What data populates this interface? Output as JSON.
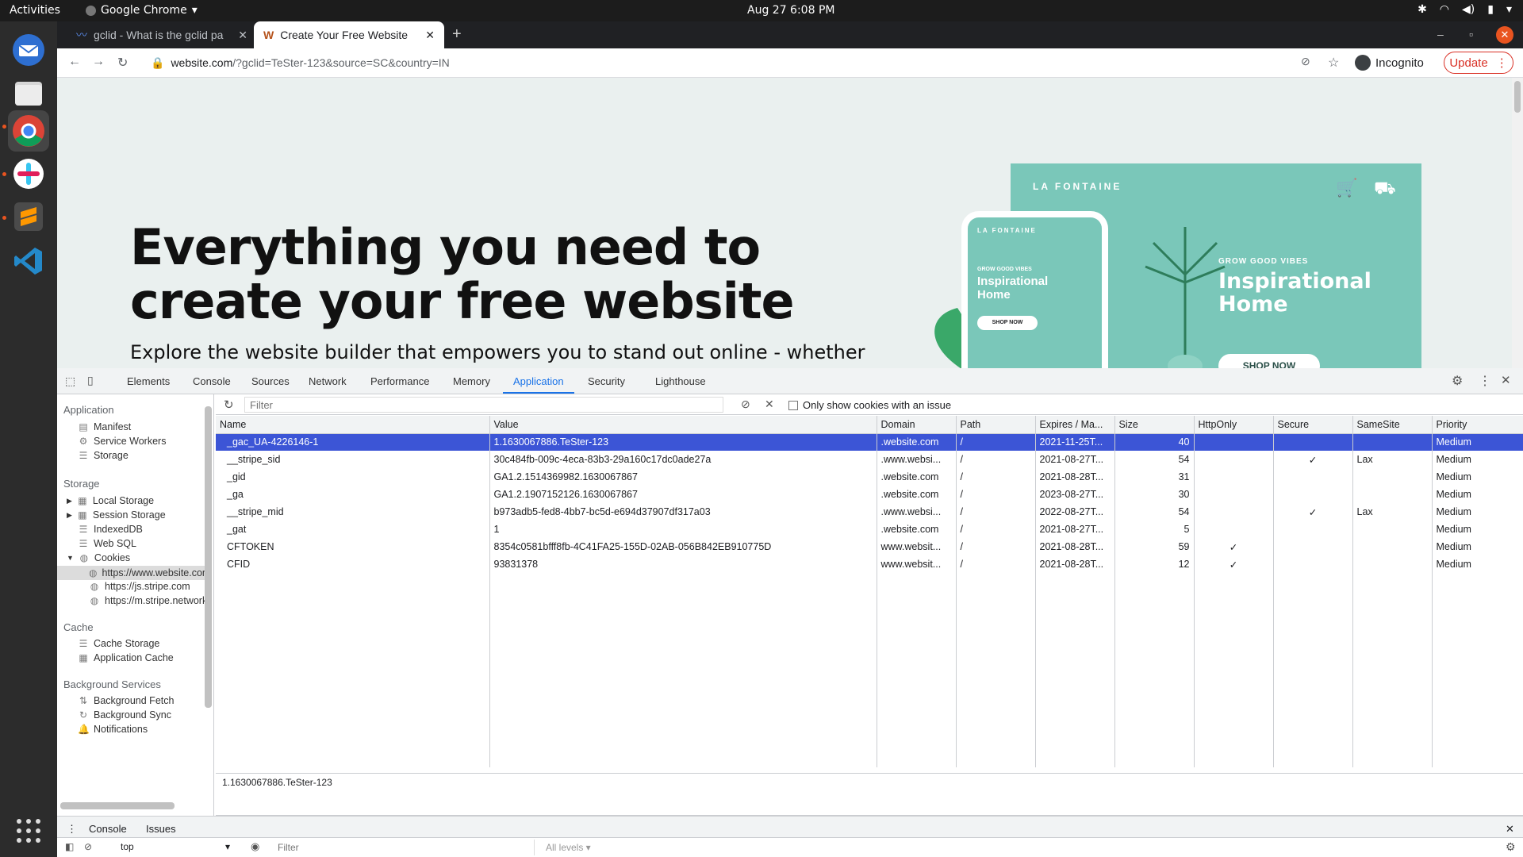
{
  "os": {
    "activities": "Activities",
    "app_name": "Google Chrome",
    "clock": "Aug 27  6:08 PM"
  },
  "tabs": [
    {
      "title": "gclid - What is the gclid pa",
      "active": false
    },
    {
      "title": "Create Your Free Website",
      "active": true
    }
  ],
  "omnibox": {
    "domain": "website.com",
    "path": "/?gclid=TeSter-123&source=SC&country=IN"
  },
  "incognito": "Incognito",
  "update": "Update",
  "page": {
    "hero_title": "Everything you need to create your free website",
    "hero_sub": "Explore the website builder that empowers you to stand out online - whether",
    "promo_brand": "LA FONTAINE",
    "promo_small": "GROW GOOD VIBES",
    "promo_big": "Inspirational Home",
    "promo_shop": "SHOP NOW",
    "phone_brand": "LA FONTAINE",
    "phone_small": "GROW GOOD VIBES",
    "phone_title": "Inspirational Home",
    "phone_shop": "SHOP NOW"
  },
  "devtools": {
    "tabs": [
      "Elements",
      "Console",
      "Sources",
      "Network",
      "Performance",
      "Memory",
      "Application",
      "Security",
      "Lighthouse"
    ],
    "active_tab": "Application",
    "sidebar": {
      "app_header": "Application",
      "app_items": [
        "Manifest",
        "Service Workers",
        "Storage"
      ],
      "storage_header": "Storage",
      "storage_items": [
        "Local Storage",
        "Session Storage",
        "IndexedDB",
        "Web SQL",
        "Cookies"
      ],
      "cookie_sources": [
        "https://www.website.com",
        "https://js.stripe.com",
        "https://m.stripe.network"
      ],
      "cache_header": "Cache",
      "cache_items": [
        "Cache Storage",
        "Application Cache"
      ],
      "bg_header": "Background Services",
      "bg_items": [
        "Background Fetch",
        "Background Sync",
        "Notifications"
      ]
    },
    "filter_placeholder": "Filter",
    "only_issue_label": "Only show cookies with an issue",
    "columns": [
      "Name",
      "Value",
      "Domain",
      "Path",
      "Expires / Ma...",
      "Size",
      "HttpOnly",
      "Secure",
      "SameSite",
      "Priority"
    ],
    "rows": [
      [
        "_gac_UA-4226146-1",
        "1.1630067886.TeSter-123",
        ".website.com",
        "/",
        "2021-11-25T...",
        "40",
        "",
        "",
        "",
        "Medium"
      ],
      [
        "__stripe_sid",
        "30c484fb-009c-4eca-83b3-29a160c17dc0ade27a",
        ".www.websi...",
        "/",
        "2021-08-27T...",
        "54",
        "",
        "✓",
        "Lax",
        "Medium"
      ],
      [
        "_gid",
        "GA1.2.1514369982.1630067867",
        ".website.com",
        "/",
        "2021-08-28T...",
        "31",
        "",
        "",
        "",
        "Medium"
      ],
      [
        "_ga",
        "GA1.2.1907152126.1630067867",
        ".website.com",
        "/",
        "2023-08-27T...",
        "30",
        "",
        "",
        "",
        "Medium"
      ],
      [
        "__stripe_mid",
        "b973adb5-fed8-4bb7-bc5d-e694d37907df317a03",
        ".www.websi...",
        "/",
        "2022-08-27T...",
        "54",
        "",
        "✓",
        "Lax",
        "Medium"
      ],
      [
        "_gat",
        "1",
        ".website.com",
        "/",
        "2021-08-27T...",
        "5",
        "",
        "",
        "",
        "Medium"
      ],
      [
        "CFTOKEN",
        "8354c0581bfff8fb-4C41FA25-155D-02AB-056B842EB910775D",
        "www.websit...",
        "/",
        "2021-08-28T...",
        "59",
        "✓",
        "",
        "",
        "Medium"
      ],
      [
        "CFID",
        "93831378",
        "www.websit...",
        "/",
        "2021-08-28T...",
        "12",
        "✓",
        "",
        "",
        "Medium"
      ]
    ],
    "selected_value": "1.1630067886.TeSter-123",
    "drawer_tabs": [
      "Console",
      "Issues"
    ],
    "console_context": "top",
    "console_filter": "Filter",
    "levels": "All levels ▾"
  },
  "colors": {
    "selection": "#3c55d6",
    "accent": "#1a73e8",
    "promo": "#7ac7b9",
    "update": "#d93025"
  }
}
